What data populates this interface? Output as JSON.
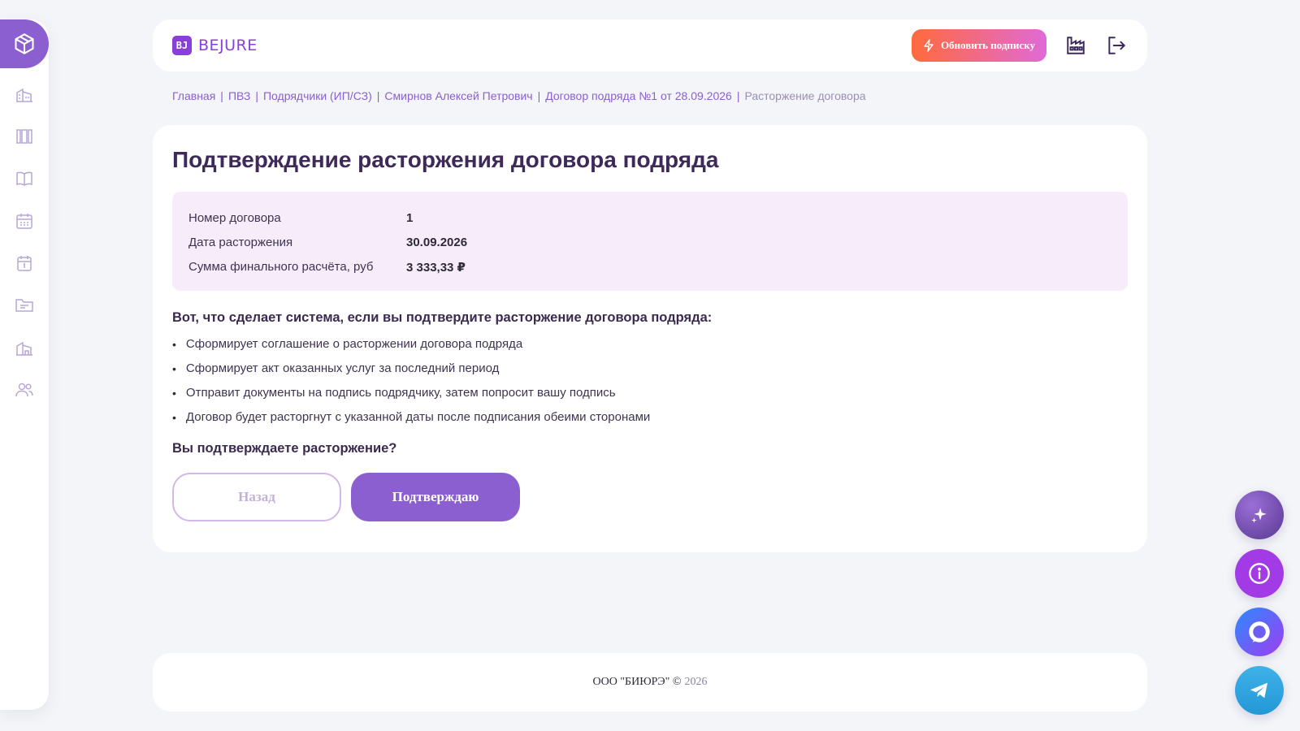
{
  "sidebar": {
    "items": [
      {
        "icon": "box-icon",
        "name": "home"
      },
      {
        "icon": "building-icon",
        "name": "organizations"
      },
      {
        "icon": "columns-icon",
        "name": "registry"
      },
      {
        "icon": "book-icon",
        "name": "handbook"
      },
      {
        "icon": "calendar-grid-icon",
        "name": "schedule"
      },
      {
        "icon": "calendar-day-icon",
        "name": "calendar"
      },
      {
        "icon": "folder-icon",
        "name": "documents"
      },
      {
        "icon": "warehouse-icon",
        "name": "pvz"
      },
      {
        "icon": "users-icon",
        "name": "contractors"
      }
    ]
  },
  "header": {
    "logo_mark": "BJ",
    "logo_text": "BEJURE",
    "upgrade_label": "Обновить подписку"
  },
  "breadcrumb": {
    "items": [
      "Главная",
      "ПВЗ",
      "Подрядчики (ИП/СЗ)",
      "Смирнов Алексей Петрович",
      "Договор подряда №1 от 28.09.2026"
    ],
    "current": "Расторжение договора"
  },
  "main": {
    "title": "Подтверждение расторжения договора подряда",
    "info": [
      {
        "label": "Номер договора",
        "value": "1"
      },
      {
        "label": "Дата расторжения",
        "value": "30.09.2026"
      },
      {
        "label": "Сумма финального расчёта, руб",
        "value": "3 333,33 ₽"
      }
    ],
    "question": "Вот, что сделает система, если вы подтвердите расторжение договора подряда:",
    "actions": [
      "Сформирует соглашение о расторжении договора подряда",
      "Сформирует акт оказанных услуг за последний период",
      "Отправит документы на подпись подрядчику, затем попросит вашу подпись",
      "Договор будет расторгнут с указанной даты после подписания обеими сторонами"
    ],
    "confirm_question": "Вы подтверждаете расторжение?",
    "back_label": "Назад",
    "confirm_label": "Подтверждаю"
  },
  "footer": {
    "company": "ООО \"БИЮРЭ\" ©",
    "year": "2026"
  },
  "colors": {
    "accent": "#8c5fd1",
    "info_bg": "#f7ecfa",
    "upgrade_from": "#ff6a3d",
    "upgrade_to": "#e06ad6"
  }
}
